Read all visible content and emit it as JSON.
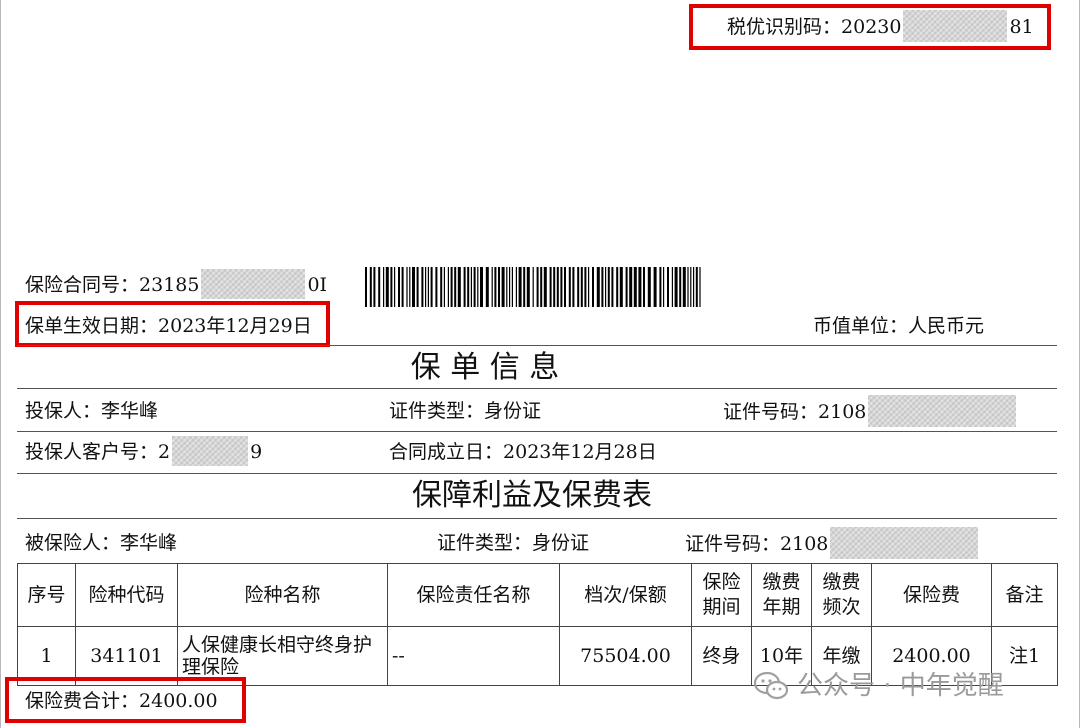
{
  "tax_code": {
    "label": "税优识别码：",
    "prefix": "20230",
    "suffix": "81"
  },
  "contract_no": {
    "label": "保险合同号：",
    "prefix": "23185",
    "suffix": "0I"
  },
  "effective_date": {
    "label": "保单生效日期：",
    "value": "2023年12月29日"
  },
  "currency": {
    "label": "币值单位：",
    "value": "人民币元"
  },
  "policy_info": {
    "title": "保 单 信 息",
    "applicant_label": "投保人：",
    "applicant_value": "李华峰",
    "id_type_label": "证件类型：",
    "id_type_value": "身份证",
    "id_no_label": "证件号码：",
    "id_no_prefix": "2108",
    "customer_no_label": "投保人客户号：",
    "customer_no_prefix": "2",
    "customer_no_suffix": "9",
    "established_label": "合同成立日：",
    "established_value": "2023年12月28日"
  },
  "coverage": {
    "title": "保障利益及保费表",
    "insured_label": "被保险人：",
    "insured_value": "李华峰",
    "id_type_label": "证件类型：",
    "id_type_value": "身份证",
    "id_no_label": "证件号码：",
    "id_no_prefix": "2108",
    "headers": [
      "序号",
      "险种代码",
      "险种名称",
      "保险责任名称",
      "档次/保额",
      "保险期间",
      "缴费年期",
      "缴费频次",
      "保险费",
      "备注"
    ],
    "rows": [
      [
        "1",
        "341101",
        "人保健康长相守终身护理保险",
        "--",
        "75504.00",
        "终身",
        "10年",
        "年缴",
        "2400.00",
        "注1"
      ]
    ]
  },
  "premium_total": {
    "label": "保险费合计：",
    "value": "2400.00"
  },
  "watermark": {
    "text": "公众号 · 中年觉醒"
  }
}
